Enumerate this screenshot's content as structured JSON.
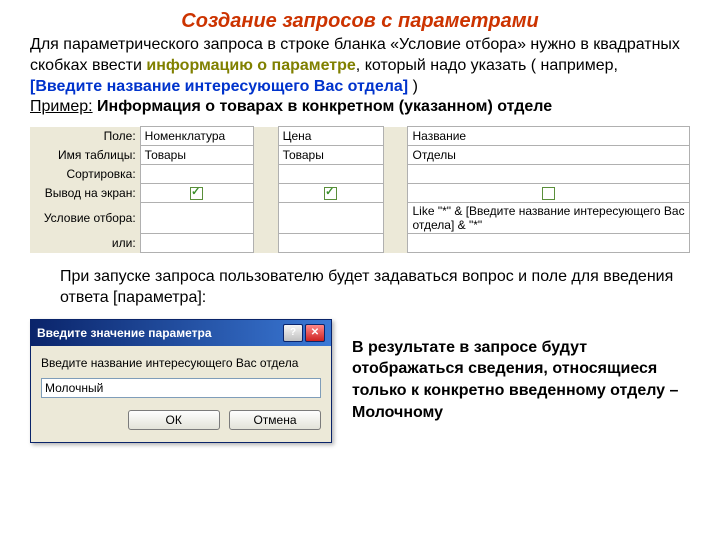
{
  "title": "Создание  запросов  с параметрами",
  "intro_prefix": "Для параметрического запроса в строке бланка «Условие отбора» нужно в квадратных скобках ввести ",
  "intro_olive": "информацию о параметре",
  "intro_mid": ", который надо указать ( например, ",
  "intro_tag": "[Введите название интересующего Вас отдела]",
  "intro_suffix": " )",
  "example_label": "Пример:",
  "example_text": " Информация о товарах в конкретном (указанном) отделе",
  "grid": {
    "rows": [
      "Поле:",
      "Имя таблицы:",
      "Сортировка:",
      "Вывод на экран:",
      "Условие отбора:",
      "или:"
    ],
    "r0": {
      "c1": "Номенклатура",
      "c3": "Цена",
      "c5": "Название"
    },
    "r1": {
      "c1": "Товары",
      "c3": "Товары",
      "c5": "Отделы"
    },
    "r4": {
      "c5": "Like \"*\" & [Введите название интересующего Вас отдела] & \"*\""
    }
  },
  "para2": "При запуске запроса пользователю будет задаваться вопрос и поле для введения ответа [параметра]:",
  "dialog": {
    "title": "Введите значение параметра",
    "label": "Введите название интересующего Вас отдела",
    "value": "Молочный",
    "ok": "ОК",
    "cancel": "Отмена"
  },
  "result_prefix": "В результате в запросе будут отображаться сведения, относящиеся только к конкретно введенному отделу – ",
  "result_bold": "Молочному"
}
